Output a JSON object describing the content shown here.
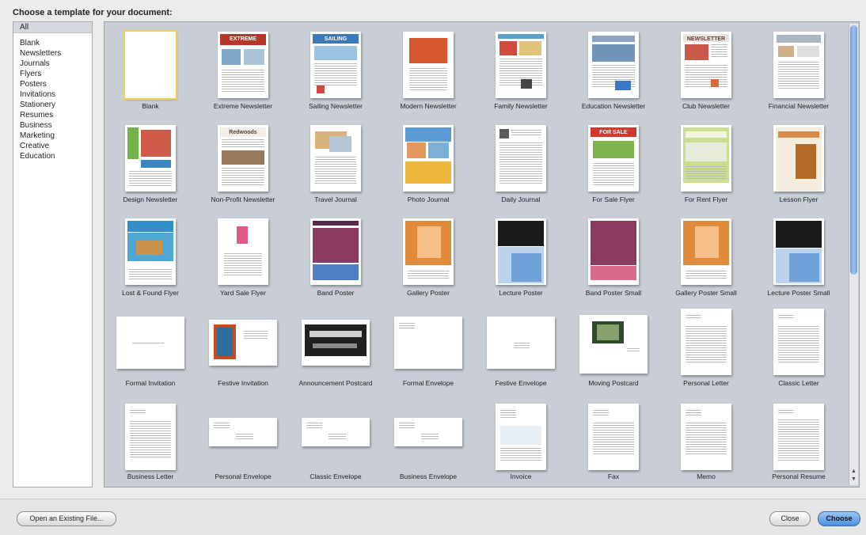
{
  "title": "Choose a template for your document:",
  "categories": [
    "All",
    "Blank",
    "Newsletters",
    "Journals",
    "Flyers",
    "Posters",
    "Invitations",
    "Stationery",
    "Resumes",
    "Business",
    "Marketing",
    "Creative",
    "Education"
  ],
  "templates": [
    {
      "name": "Blank",
      "icon": "blank-page-icon"
    },
    {
      "name": "Extreme Newsletter",
      "icon": "newsletter-icon",
      "banner": "EXTREME"
    },
    {
      "name": "Sailing Newsletter",
      "icon": "newsletter-icon",
      "banner": "SAILING"
    },
    {
      "name": "Modern Newsletter",
      "icon": "newsletter-icon"
    },
    {
      "name": "Family Newsletter",
      "icon": "newsletter-icon"
    },
    {
      "name": "Education Newsletter",
      "icon": "newsletter-icon"
    },
    {
      "name": "Club Newsletter",
      "icon": "newsletter-icon",
      "banner": "NEWSLETTER"
    },
    {
      "name": "Financial Newsletter",
      "icon": "newsletter-icon"
    },
    {
      "name": "Design Newsletter",
      "icon": "newsletter-icon"
    },
    {
      "name": "Non-Profit Newsletter",
      "icon": "newsletter-icon",
      "banner": "Redwoods"
    },
    {
      "name": "Travel Journal",
      "icon": "journal-icon"
    },
    {
      "name": "Photo Journal",
      "icon": "journal-icon"
    },
    {
      "name": "Daily Journal",
      "icon": "journal-icon"
    },
    {
      "name": "For Sale Flyer",
      "icon": "flyer-icon",
      "banner": "FOR SALE"
    },
    {
      "name": "For Rent Flyer",
      "icon": "flyer-icon"
    },
    {
      "name": "Lesson Flyer",
      "icon": "flyer-icon"
    },
    {
      "name": "Lost & Found Flyer",
      "icon": "flyer-icon"
    },
    {
      "name": "Yard Sale Flyer",
      "icon": "flyer-icon"
    },
    {
      "name": "Band Poster",
      "icon": "poster-icon"
    },
    {
      "name": "Gallery Poster",
      "icon": "poster-icon"
    },
    {
      "name": "Lecture Poster",
      "icon": "poster-icon"
    },
    {
      "name": "Band Poster Small",
      "icon": "poster-icon"
    },
    {
      "name": "Gallery Poster Small",
      "icon": "poster-icon"
    },
    {
      "name": "Lecture Poster Small",
      "icon": "poster-icon"
    },
    {
      "name": "Formal Invitation",
      "icon": "invitation-icon"
    },
    {
      "name": "Festive Invitation",
      "icon": "invitation-icon"
    },
    {
      "name": "Announcement Postcard",
      "icon": "postcard-icon"
    },
    {
      "name": "Formal Envelope",
      "icon": "envelope-icon"
    },
    {
      "name": "Festive Envelope",
      "icon": "envelope-icon"
    },
    {
      "name": "Moving Postcard",
      "icon": "postcard-icon"
    },
    {
      "name": "Personal Letter",
      "icon": "letter-icon"
    },
    {
      "name": "Classic Letter",
      "icon": "letter-icon"
    },
    {
      "name": "Business Letter",
      "icon": "letter-icon"
    },
    {
      "name": "Personal Envelope",
      "icon": "envelope-icon"
    },
    {
      "name": "Classic Envelope",
      "icon": "envelope-icon"
    },
    {
      "name": "Business Envelope",
      "icon": "envelope-icon"
    },
    {
      "name": "Invoice",
      "icon": "invoice-icon"
    },
    {
      "name": "Fax",
      "icon": "fax-icon"
    },
    {
      "name": "Memo",
      "icon": "memo-icon"
    },
    {
      "name": "Personal Resume",
      "icon": "resume-icon"
    }
  ],
  "buttons": {
    "open_existing": "Open an Existing File...",
    "close": "Close",
    "choose": "Choose"
  },
  "colors": {
    "accent": "#4b8fe2",
    "selection": "#f1d24a",
    "grid_bg": "#c9ced6"
  }
}
